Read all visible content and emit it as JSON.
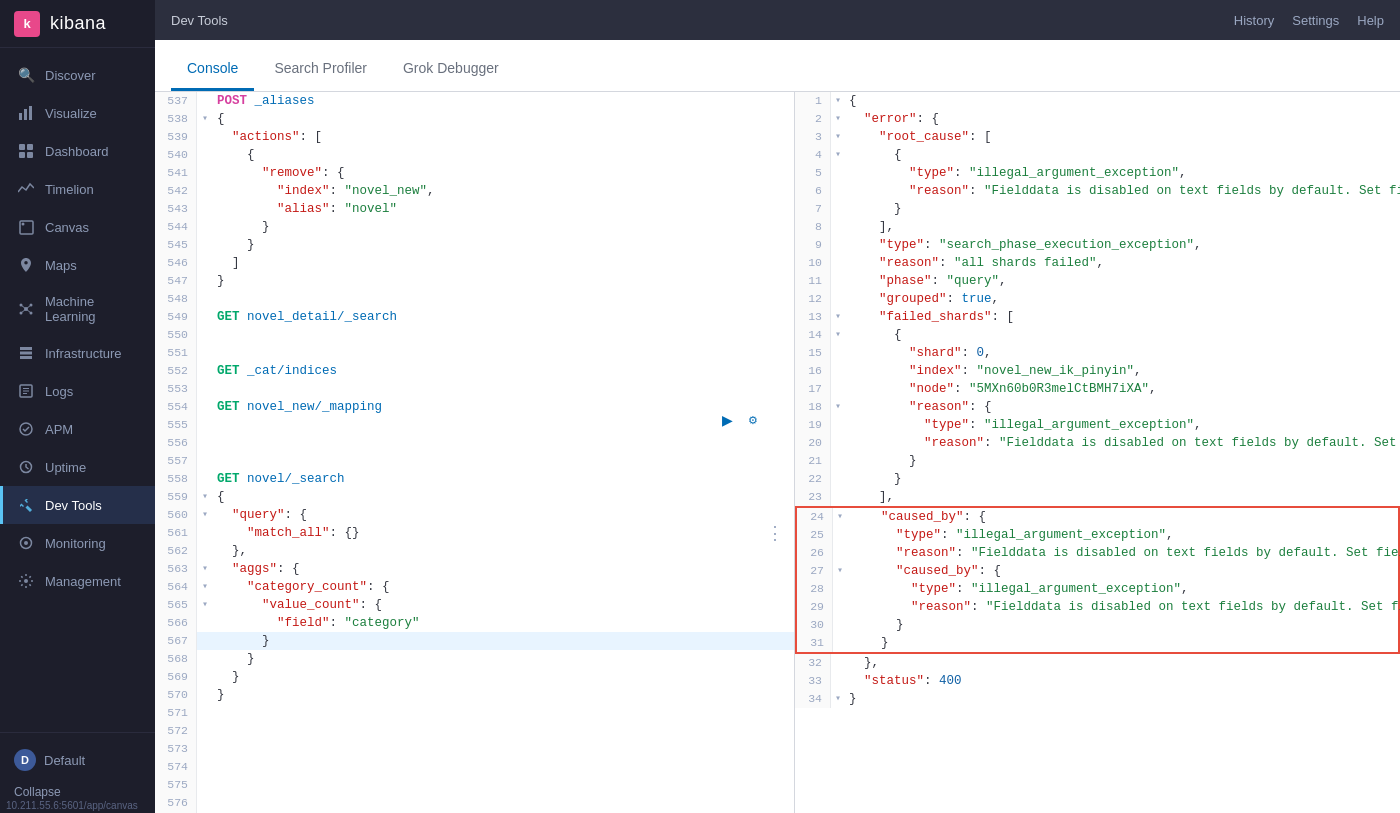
{
  "app": {
    "title": "kibana",
    "logo_letter": "k"
  },
  "topbar": {
    "title": "Dev Tools",
    "history": "History",
    "settings": "Settings",
    "help": "Help"
  },
  "tabs": [
    {
      "id": "console",
      "label": "Console",
      "active": true
    },
    {
      "id": "search-profiler",
      "label": "Search Profiler",
      "active": false
    },
    {
      "id": "grok-debugger",
      "label": "Grok Debugger",
      "active": false
    }
  ],
  "sidebar": {
    "items": [
      {
        "id": "discover",
        "label": "Discover",
        "icon": "🔍"
      },
      {
        "id": "visualize",
        "label": "Visualize",
        "icon": "📊"
      },
      {
        "id": "dashboard",
        "label": "Dashboard",
        "icon": "▦"
      },
      {
        "id": "timelion",
        "label": "Timelion",
        "icon": "📈"
      },
      {
        "id": "canvas",
        "label": "Canvas",
        "icon": "◻"
      },
      {
        "id": "maps",
        "label": "Maps",
        "icon": "🗺"
      },
      {
        "id": "machine-learning",
        "label": "Machine Learning",
        "icon": "⚙"
      },
      {
        "id": "infrastructure",
        "label": "Infrastructure",
        "icon": "☁"
      },
      {
        "id": "logs",
        "label": "Logs",
        "icon": "📋"
      },
      {
        "id": "apm",
        "label": "APM",
        "icon": "◈"
      },
      {
        "id": "uptime",
        "label": "Uptime",
        "icon": "♡"
      },
      {
        "id": "dev-tools",
        "label": "Dev Tools",
        "icon": "🔧"
      },
      {
        "id": "monitoring",
        "label": "Monitoring",
        "icon": "◉"
      },
      {
        "id": "management",
        "label": "Management",
        "icon": "⚙"
      }
    ],
    "user": "Default",
    "collapse": "Collapse",
    "ip": "10.211.55.6:5601/app/canvas"
  }
}
